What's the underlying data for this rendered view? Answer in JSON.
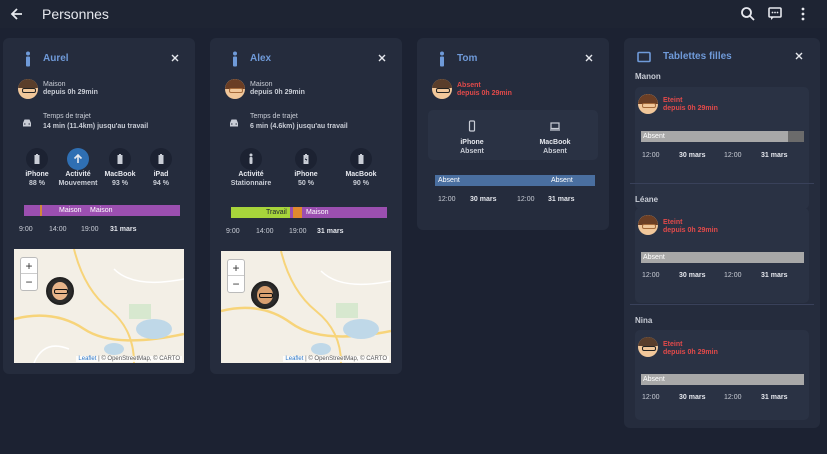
{
  "header": {
    "title": "Personnes"
  },
  "cards": [
    {
      "name": "Aurel",
      "location": {
        "place": "Maison",
        "since": "depuis 0h 29min"
      },
      "travel": {
        "title": "Temps de trajet",
        "detail": "14 min (11.4km) jusqu'au travail"
      },
      "devices": [
        {
          "name": "iPhone",
          "value": "88 %",
          "icon": "battery-icon"
        },
        {
          "name": "Activité",
          "value": "Mouvement",
          "icon": "arrow-up-icon"
        },
        {
          "name": "MacBook",
          "value": "93 %",
          "icon": "battery-icon"
        },
        {
          "name": "iPad",
          "value": "94 %",
          "icon": "battery-icon"
        }
      ],
      "timeline": {
        "labels": [
          "Maison",
          "Maison"
        ],
        "ticks": [
          "9:00",
          "14:00",
          "19:00",
          "31 mars"
        ]
      },
      "map": {
        "attribution_leaflet": "Leaflet",
        "attribution_rest": "| © OpenStreetMap, © CARTO"
      }
    },
    {
      "name": "Alex",
      "location": {
        "place": "Maison",
        "since": "depuis 0h 29min"
      },
      "travel": {
        "title": "Temps de trajet",
        "detail": "6 min (4.6km) jusqu'au travail"
      },
      "devices": [
        {
          "name": "Activité",
          "value": "Stationnaire",
          "icon": "person-icon"
        },
        {
          "name": "iPhone",
          "value": "50 %",
          "icon": "battery-charging-icon"
        },
        {
          "name": "MacBook",
          "value": "90 %",
          "icon": "battery-icon"
        }
      ],
      "timeline": {
        "labels": [
          "Travail",
          "Maison"
        ],
        "ticks": [
          "9:00",
          "14:00",
          "19:00",
          "31 mars"
        ]
      },
      "map": {
        "attribution_leaflet": "Leaflet",
        "attribution_rest": "| © OpenStreetMap, © CARTO"
      }
    },
    {
      "name": "Tom",
      "location": {
        "place": "Absent",
        "since": "depuis 0h 29min"
      },
      "devices": [
        {
          "name": "iPhone",
          "value": "Absent",
          "icon": "phone-icon"
        },
        {
          "name": "MacBook",
          "value": "Absent",
          "icon": "laptop-icon"
        }
      ],
      "timeline": {
        "labels": [
          "Absent",
          "Absent"
        ],
        "ticks": [
          "12:00",
          "30 mars",
          "12:00",
          "31 mars"
        ]
      }
    }
  ],
  "tablets": {
    "title": "Tablettes filles",
    "people": [
      {
        "name": "Manon",
        "status": "Eteint",
        "since": "depuis 0h 29min",
        "bar_label": "Absent",
        "ticks": [
          "12:00",
          "30 mars",
          "12:00",
          "31 mars"
        ]
      },
      {
        "name": "Léane",
        "status": "Eteint",
        "since": "depuis 0h 29min",
        "bar_label": "Absent",
        "ticks": [
          "12:00",
          "30 mars",
          "12:00",
          "31 mars"
        ]
      },
      {
        "name": "Nina",
        "status": "Eteint",
        "since": "depuis 0h 29min",
        "bar_label": "Absent",
        "ticks": [
          "12:00",
          "30 mars",
          "12:00",
          "31 mars"
        ]
      }
    ]
  },
  "colors": {
    "accent": "#6f9ad9",
    "home": "#9b4fb0",
    "work": "#a7d43b",
    "absent_blue": "#4a6fa0",
    "absent_grey": "#a8a8a8",
    "alert": "#e24a4a"
  },
  "icons": {
    "back": "arrow-left-icon",
    "search": "search-icon",
    "chat": "message-icon",
    "menu": "more-vert-icon"
  }
}
